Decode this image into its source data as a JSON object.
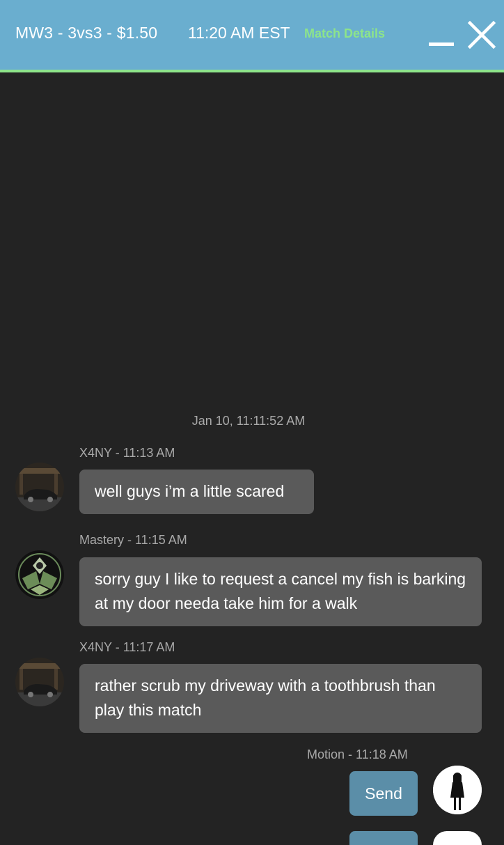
{
  "header": {
    "match_title": "MW3 - 3vs3 - $1.50",
    "match_time": "11:20 AM EST",
    "details_link": "Match Details",
    "minimize_icon": "minimize-icon",
    "close_icon": "close-icon",
    "colors": {
      "bar": "#6aaecf",
      "accent": "#8de48a"
    }
  },
  "chat": {
    "date_divider": "Jan 10, 11:11:52 AM",
    "messages": [
      {
        "meta": "X4NY - 11:13 AM",
        "text": "well guys i’m a little scared",
        "avatar": "car-avatar"
      },
      {
        "meta": "Mastery - 11:15 AM",
        "text": "sorry guy I like to request a cancel my fish is barking at my door needa take him for a walk",
        "avatar": "emblem-avatar"
      },
      {
        "meta": "X4NY - 11:17 AM",
        "text": "rather scrub my driveway with a toothbrush than play this match",
        "avatar": "car-avatar"
      },
      {
        "meta": "Motion - 11:18 AM",
        "text": "Send",
        "avatar": "silhouette-avatar"
      }
    ]
  }
}
